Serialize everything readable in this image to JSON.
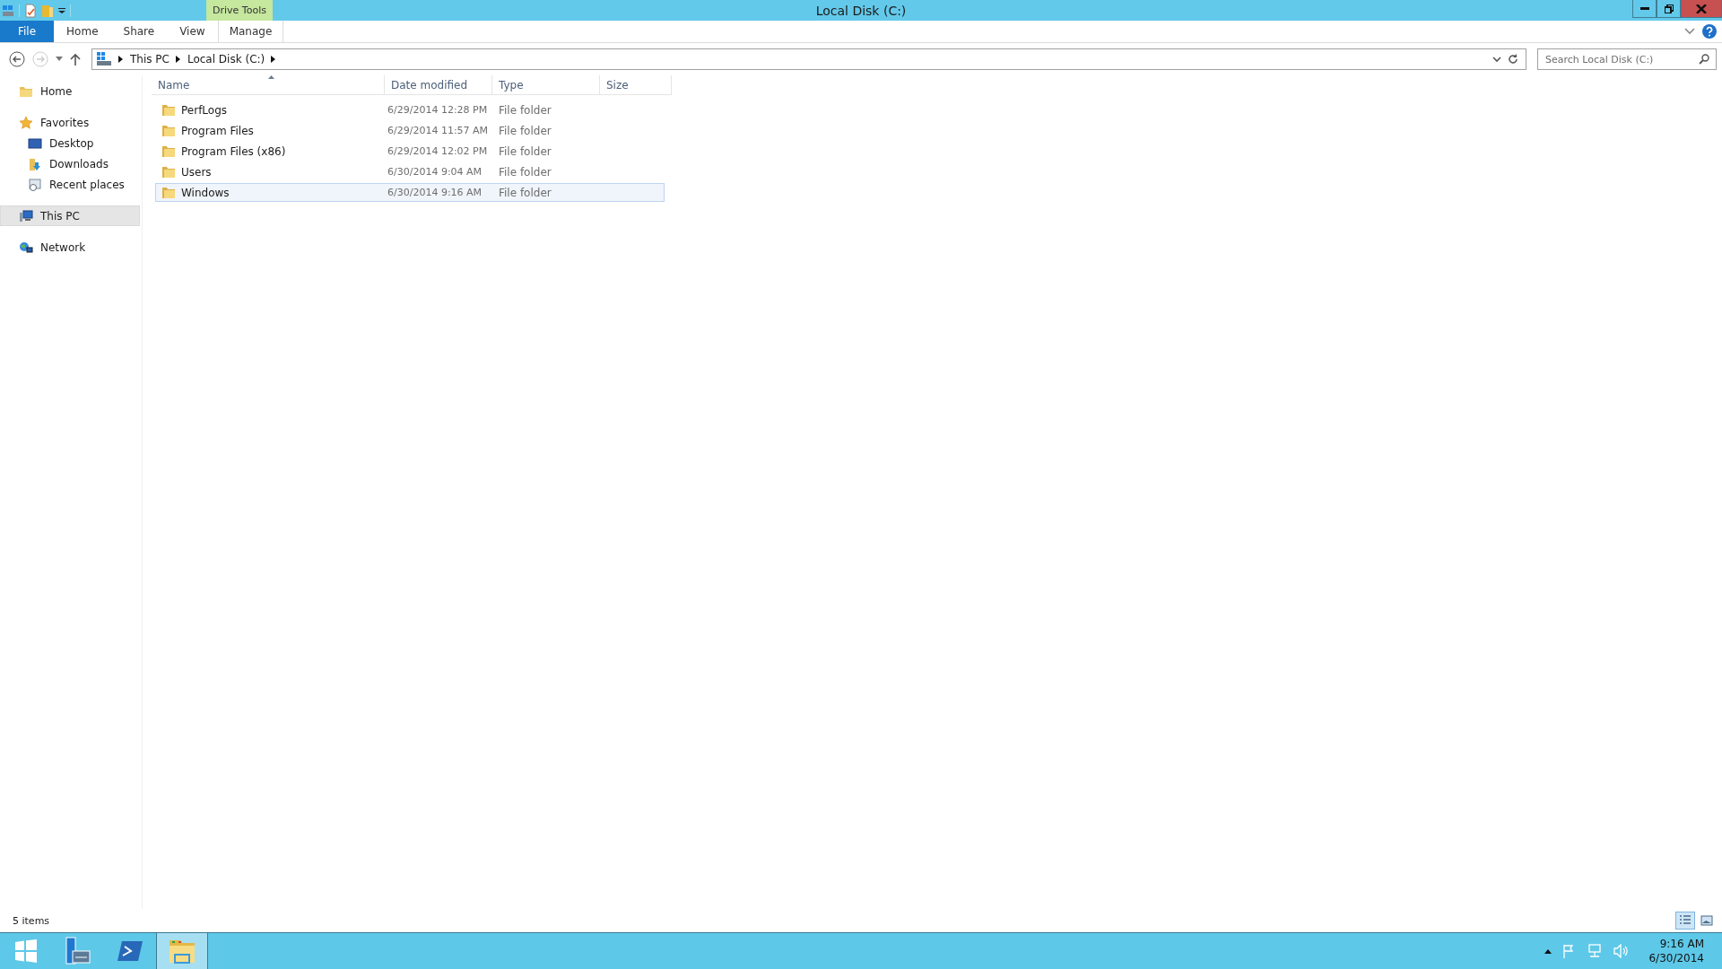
{
  "window": {
    "title": "Local Disk (C:)"
  },
  "contextual_tab_group": {
    "label": "Drive Tools"
  },
  "ribbon_tabs": [
    {
      "label": "File",
      "kind": "file",
      "selected": false
    },
    {
      "label": "Home",
      "kind": "tab",
      "selected": false
    },
    {
      "label": "Share",
      "kind": "tab",
      "selected": false
    },
    {
      "label": "View",
      "kind": "tab",
      "selected": false
    },
    {
      "label": "Manage",
      "kind": "contextual",
      "selected": false
    }
  ],
  "address_bar": {
    "breadcrumbs": [
      "This PC",
      "Local Disk (C:)"
    ]
  },
  "search": {
    "placeholder": "Search Local Disk (C:)"
  },
  "navigation_pane": {
    "items": [
      {
        "label": "Home",
        "kind": "folder",
        "selected": false
      },
      {
        "label": "Favorites",
        "kind": "star",
        "selected": false,
        "children": [
          {
            "label": "Desktop",
            "kind": "desktop",
            "selected": false
          },
          {
            "label": "Downloads",
            "kind": "downloads",
            "selected": false
          },
          {
            "label": "Recent places",
            "kind": "recent",
            "selected": false
          }
        ]
      },
      {
        "label": "This PC",
        "kind": "pc",
        "selected": true
      },
      {
        "label": "Network",
        "kind": "network",
        "selected": false
      }
    ]
  },
  "table": {
    "columns": [
      {
        "label": "Name",
        "sorted": true
      },
      {
        "label": "Date modified",
        "sorted": false
      },
      {
        "label": "Type",
        "sorted": false
      },
      {
        "label": "Size",
        "sorted": false
      }
    ],
    "rows": [
      {
        "name": "PerfLogs",
        "date_modified": "6/29/2014 12:28 PM",
        "type": "File folder",
        "selected": false
      },
      {
        "name": "Program Files",
        "date_modified": "6/29/2014 11:57 AM",
        "type": "File folder",
        "selected": false
      },
      {
        "name": "Program Files (x86)",
        "date_modified": "6/29/2014 12:02 PM",
        "type": "File folder",
        "selected": false
      },
      {
        "name": "Users",
        "date_modified": "6/30/2014 9:04 AM",
        "type": "File folder",
        "selected": false
      },
      {
        "name": "Windows",
        "date_modified": "6/30/2014 9:16 AM",
        "type": "File folder",
        "selected": true
      }
    ]
  },
  "status_bar": {
    "text": "5 items",
    "view_buttons": [
      {
        "kind": "details",
        "selected": true
      },
      {
        "kind": "large-icons",
        "selected": false
      }
    ]
  },
  "taskbar": {
    "apps": [
      {
        "kind": "start",
        "active": false
      },
      {
        "kind": "server-manager",
        "active": false
      },
      {
        "kind": "powershell",
        "active": false
      },
      {
        "kind": "file-explorer",
        "active": true
      }
    ],
    "clock": {
      "time": "9:16 AM",
      "date": "6/30/2014"
    }
  }
}
